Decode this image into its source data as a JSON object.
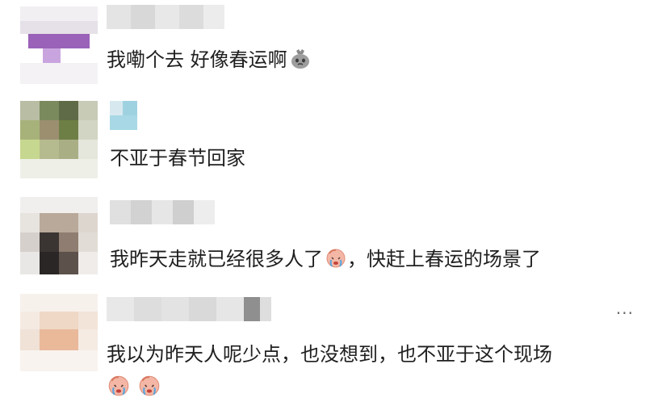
{
  "comments": [
    {
      "text": "我嘞个去 好像春运啊",
      "emoji": "bag-emoji"
    },
    {
      "text": "不亚于春节回家"
    },
    {
      "text_before": "我昨天走就已经很多人了",
      "emoji": "crying-face-emoji",
      "text_after": "，快赶上春运的场景了"
    },
    {
      "text": "我以为昨天人呢少点，也没想到，也不亚于这个现场",
      "emojis": [
        "crying-face-emoji",
        "crying-face-emoji"
      ],
      "more_label": "···"
    }
  ]
}
